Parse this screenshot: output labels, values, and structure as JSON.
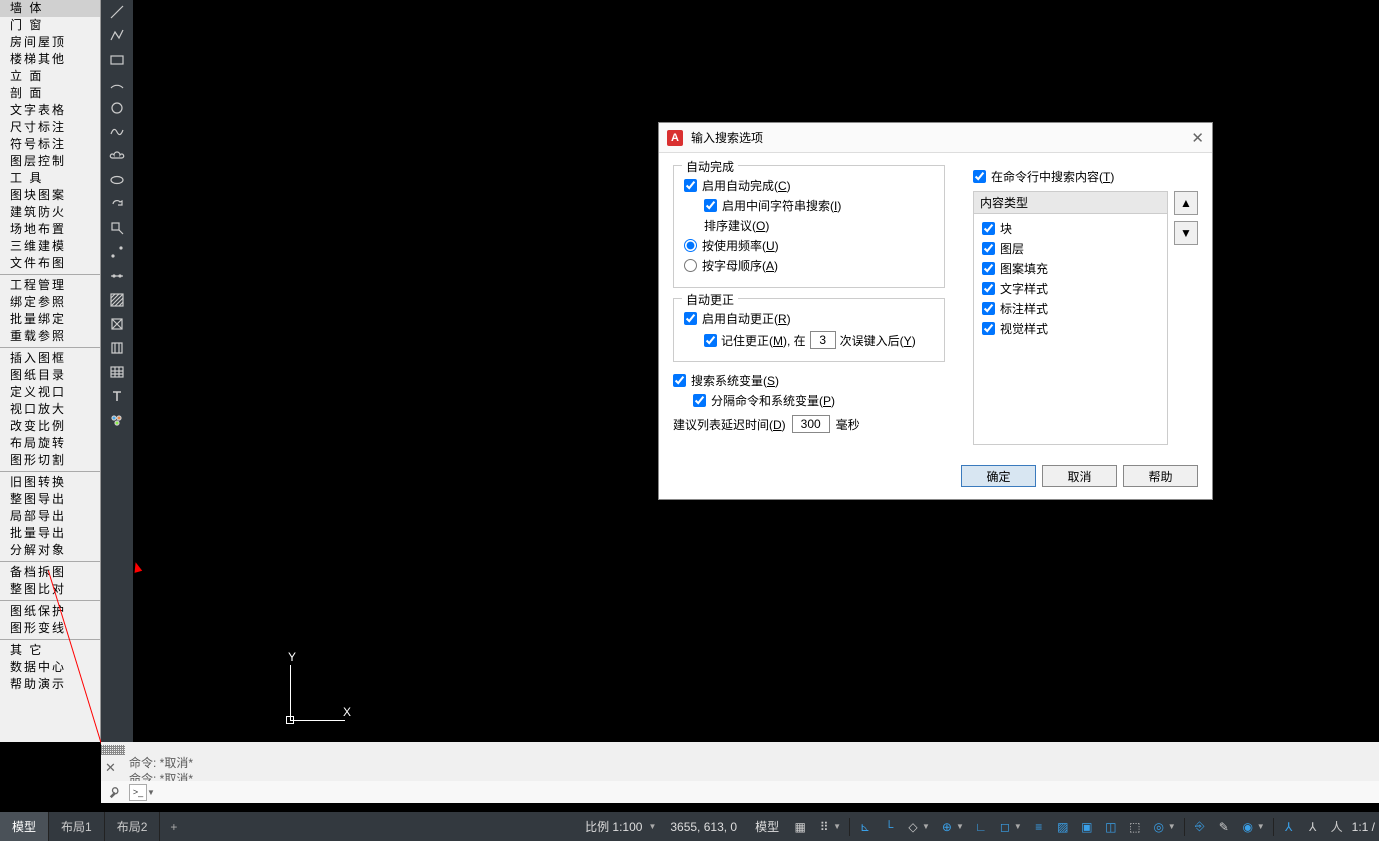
{
  "sidebar": {
    "items": [
      "墙    体",
      "门    窗",
      "房间屋顶",
      "楼梯其他",
      "立    面",
      "剖    面",
      "文字表格",
      "尺寸标注",
      "符号标注",
      "图层控制",
      "工    具",
      "图块图案",
      "建筑防火",
      "场地布置",
      "三维建模",
      "文件布图",
      "工程管理",
      "绑定参照",
      "批量绑定",
      "重载参照",
      "插入图框",
      "图纸目录",
      "定义视口",
      "视口放大",
      "改变比例",
      "布局旋转",
      "图形切割",
      "旧图转换",
      "整图导出",
      "局部导出",
      "批量导出",
      "分解对象",
      "备档拆图",
      "整图比对",
      "图纸保护",
      "图形变线",
      "其    它",
      "数据中心",
      "帮助演示"
    ]
  },
  "canvas": {
    "y": "Y",
    "x": "X"
  },
  "cmd": {
    "line1": "命令:  *取消*",
    "line2": "命令:  *取消*"
  },
  "tabs": {
    "items": [
      "模型",
      "布局1",
      "布局2"
    ],
    "active": 0,
    "plus": "+"
  },
  "status": {
    "scale": "比例 1:100",
    "coords": "3655, 613, 0",
    "mode": "模型",
    "ratio": "1:1 /"
  },
  "dialog": {
    "title": "输入搜索选项",
    "autocomplete": {
      "title": "自动完成",
      "enable": "启用自动完成(",
      "enable_u": "C",
      "mid": "启用中间字符串搜索(",
      "mid_u": "I",
      "sort": "排序建议(",
      "sort_u": "O",
      "freq": "按使用频率(",
      "freq_u": "U",
      "alpha": "按字母顺序(",
      "alpha_u": "A"
    },
    "autocorrect": {
      "title": "自动更正",
      "enable": "启用自动更正(",
      "enable_u": "R",
      "remember1": "记住更正(",
      "remember_u": "M",
      "remember2": "), 在",
      "remember3": "次误键入后(",
      "remember3_u": "Y",
      "value": "3"
    },
    "sysvar": {
      "search": "搜索系统变量(",
      "search_u": "S",
      "sep": "分隔命令和系统变量(",
      "sep_u": "P"
    },
    "delay": {
      "label": "建议列表延迟时间(",
      "label_u": "D",
      "value": "300",
      "unit": "毫秒"
    },
    "right": {
      "search": "在命令行中搜索内容(",
      "search_u": "T",
      "header": "内容类型",
      "types": [
        "块",
        "图层",
        "图案填充",
        "文字样式",
        "标注样式",
        "视觉样式"
      ]
    },
    "up": "▲",
    "down": "▼",
    "buttons": {
      "ok": "确定",
      "cancel": "取消",
      "help": "帮助"
    },
    "close": "✕",
    "closeparen": ")"
  }
}
